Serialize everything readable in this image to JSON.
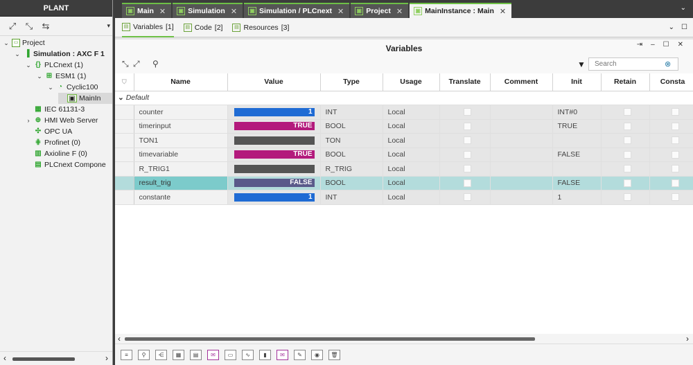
{
  "plant": {
    "title": "PLANT",
    "tree": [
      {
        "label": "Project",
        "bold": false,
        "indent": 0,
        "twisty": "v",
        "icon": "folder"
      },
      {
        "label": "Simulation : AXC F 1",
        "bold": true,
        "indent": 1,
        "twisty": "v",
        "icon": "device"
      },
      {
        "label": "PLCnext (1)",
        "bold": false,
        "indent": 2,
        "twisty": "v",
        "icon": "braces"
      },
      {
        "label": "ESM1 (1)",
        "bold": false,
        "indent": 3,
        "twisty": "v",
        "icon": "esm"
      },
      {
        "label": "Cyclic100",
        "bold": false,
        "indent": 4,
        "twisty": "v",
        "icon": "cyclic"
      },
      {
        "label": "MainIn",
        "bold": false,
        "indent": 5,
        "twisty": "",
        "icon": "instance",
        "selected": true
      },
      {
        "label": "IEC 61131-3",
        "bold": false,
        "indent": 2,
        "twisty": "",
        "icon": "iec"
      },
      {
        "label": "HMI Web Server",
        "bold": false,
        "indent": 2,
        "twisty": ">",
        "icon": "globe"
      },
      {
        "label": "OPC UA",
        "bold": false,
        "indent": 2,
        "twisty": "",
        "icon": "opc"
      },
      {
        "label": "Profinet (0)",
        "bold": false,
        "indent": 2,
        "twisty": "",
        "icon": "profinet"
      },
      {
        "label": "Axioline F (0)",
        "bold": false,
        "indent": 2,
        "twisty": "",
        "icon": "axioline"
      },
      {
        "label": "PLCnext Compone",
        "bold": false,
        "indent": 2,
        "twisty": "",
        "icon": "component"
      }
    ]
  },
  "tabs": [
    {
      "label": "Main",
      "active": false
    },
    {
      "label": "Simulation",
      "active": false
    },
    {
      "label": "Simulation / PLCnext",
      "active": false
    },
    {
      "label": "Project",
      "active": false
    },
    {
      "label": "MainInstance : Main",
      "active": true
    }
  ],
  "subtabs": [
    {
      "label": "Variables",
      "count": "[1]",
      "active": true
    },
    {
      "label": "Code",
      "count": "[2]",
      "active": false
    },
    {
      "label": "Resources",
      "count": "[3]",
      "active": false
    }
  ],
  "panel": {
    "title": "Variables",
    "search_placeholder": "Search"
  },
  "columns": [
    "Name",
    "Value",
    "Type",
    "Usage",
    "Translate",
    "Comment",
    "Init",
    "Retain",
    "Consta"
  ],
  "group": "Default",
  "rows": [
    {
      "name": "counter",
      "value": "1",
      "value_color": "#1f6bd4",
      "value_fill": 1.0,
      "type": "INT",
      "usage": "Local",
      "init": "INT#0",
      "selected": false
    },
    {
      "name": "timerinput",
      "value": "TRUE",
      "value_color": "#b31a7c",
      "value_fill": 1.0,
      "type": "BOOL",
      "usage": "Local",
      "init": "TRUE",
      "selected": false
    },
    {
      "name": "TON1",
      "value": "",
      "value_color": "#555555",
      "value_fill": 1.0,
      "type": "TON",
      "usage": "Local",
      "init": "",
      "selected": false
    },
    {
      "name": "timevariable",
      "value": "TRUE",
      "value_color": "#b31a7c",
      "value_fill": 1.0,
      "type": "BOOL",
      "usage": "Local",
      "init": "FALSE",
      "selected": false
    },
    {
      "name": "R_TRIG1",
      "value": "",
      "value_color": "#555555",
      "value_fill": 1.0,
      "type": "R_TRIG",
      "usage": "Local",
      "init": "",
      "selected": false
    },
    {
      "name": "result_trig",
      "value": "FALSE",
      "value_color": "#5a5a8a",
      "value_fill": 1.0,
      "type": "BOOL",
      "usage": "Local",
      "init": "FALSE",
      "selected": true
    },
    {
      "name": "constante",
      "value": "1",
      "value_color": "#1f6bd4",
      "value_fill": 1.0,
      "type": "INT",
      "usage": "Local",
      "init": "1",
      "selected": false
    }
  ]
}
